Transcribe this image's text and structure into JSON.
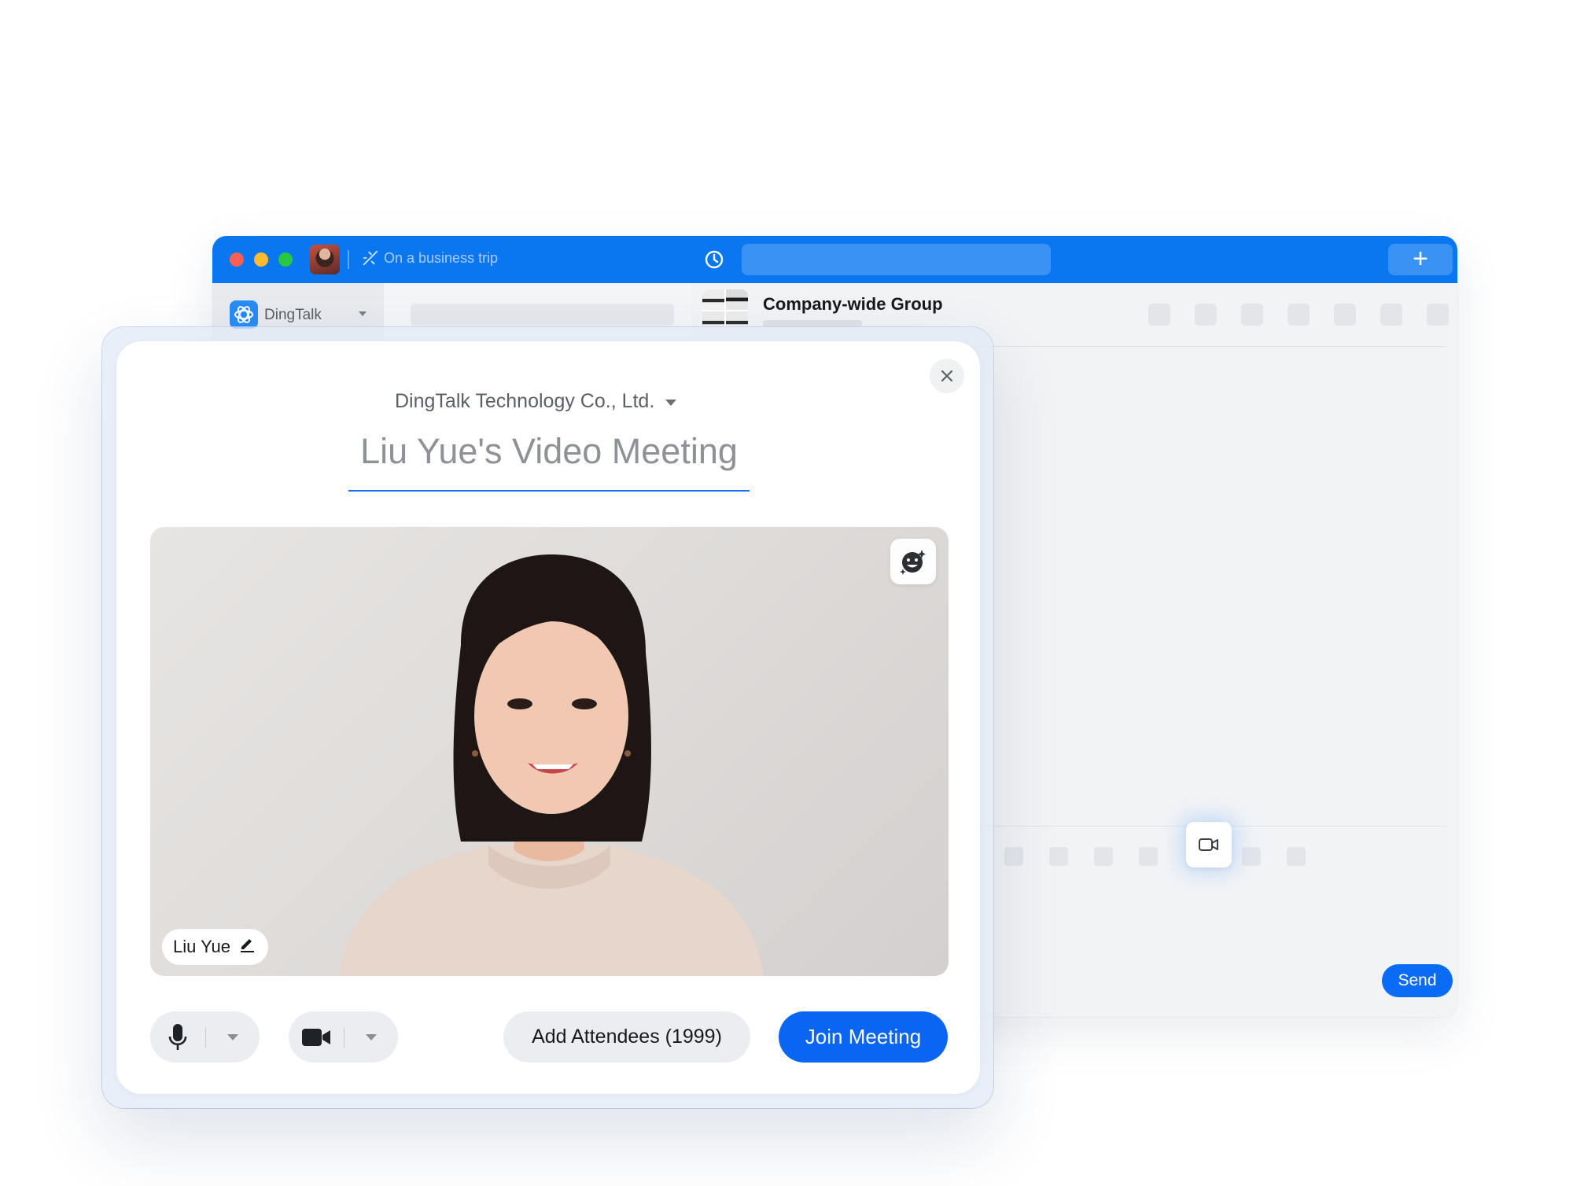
{
  "main_window": {
    "status_text": "On a business trip",
    "org_name": "DingTalk",
    "group_name": "Company-wide Group",
    "send_label": "Send"
  },
  "meeting": {
    "company": "DingTalk Technology Co., Ltd.",
    "title": "Liu Yue's Video Meeting",
    "participant_name": "Liu Yue",
    "add_attendees_label": "Add Attendees (1999)",
    "join_label": "Join Meeting"
  },
  "colors": {
    "brand_blue": "#0a77f0",
    "join_button": "#0a66f2",
    "underline": "#1a6cf0"
  },
  "icons": {
    "titlebar": [
      "history-icon",
      "plus-icon"
    ],
    "modal": [
      "close-icon",
      "face-effects-icon",
      "edit-pencil-icon",
      "microphone-icon",
      "camera-icon",
      "chevron-down-icon"
    ],
    "chat": [
      "video-call-icon"
    ]
  }
}
